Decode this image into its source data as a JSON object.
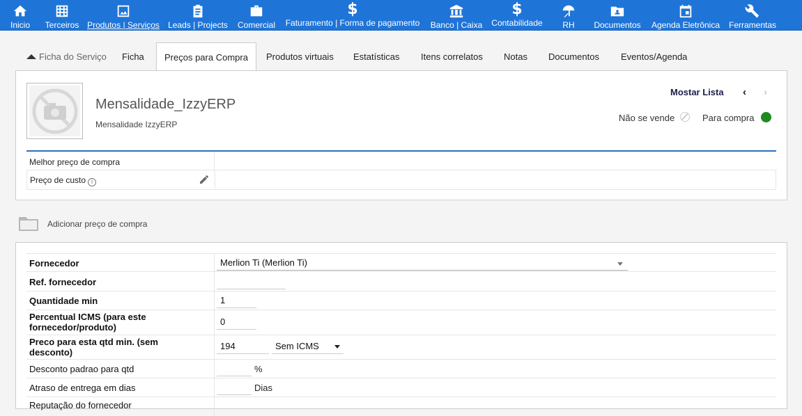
{
  "nav": {
    "items": [
      {
        "label": "Inicio",
        "icon": "home-icon"
      },
      {
        "label": "Terceiros",
        "icon": "building-icon"
      },
      {
        "label": "Produtos | Serviços",
        "icon": "image-icon"
      },
      {
        "label": "Leads | Projects",
        "icon": "clipboard-icon"
      },
      {
        "label": "Comercial",
        "icon": "briefcase-icon"
      },
      {
        "label": "Faturamento | Forma de pagamento",
        "icon": "dollar-icon"
      },
      {
        "label": "Banco | Caixa",
        "icon": "bank-icon"
      },
      {
        "label": "Contabilidade",
        "icon": "dollar-icon"
      },
      {
        "label": "RH",
        "icon": "umbrella-icon"
      },
      {
        "label": "Documentos",
        "icon": "folder-user-icon"
      },
      {
        "label": "Agenda Eletrônica",
        "icon": "calendar-icon"
      },
      {
        "label": "Ferramentas",
        "icon": "wrench-icon"
      }
    ],
    "dollar_glyph": "$"
  },
  "tabs": {
    "back": "Ficha do Serviço",
    "items": [
      "Ficha",
      "Preços para Compra",
      "Produtos virtuais",
      "Estatísticas",
      "Itens correlatos",
      "Notas",
      "Documentos",
      "Eventos/Agenda"
    ],
    "current": "Preços para Compra"
  },
  "product": {
    "title": "Mensalidade_IzzyERP",
    "subtitle": "Mensalidade IzzyERP",
    "mostrar_lista": "Mostar Lista",
    "prev_glyph": "‹",
    "next_glyph": "›",
    "nao_se_vende": "Não se vende",
    "para_compra": "Para compra",
    "status_on_color": "#1f8a1f"
  },
  "price_info": {
    "melhor_preco_label": "Melhor preço de compra",
    "preco_custo_label": "Preço de custo",
    "info_glyph": "i"
  },
  "add_price": {
    "label": "Adicionar preço de compra"
  },
  "form": {
    "fornecedor_label": "Fornecedor",
    "fornecedor_value": "Merlion Ti (Merlion Ti)",
    "ref_label": "Ref. fornecedor",
    "ref_value": "",
    "qtd_min_label": "Quantidade min",
    "qtd_min_value": "1",
    "icms_label_line1": "Percentual ICMS (para este",
    "icms_label_line2": "fornecedor/produto)",
    "icms_value": "0",
    "preco_label_line1": "Preco para esta qtd min. (sem",
    "preco_label_line2": "desconto)",
    "preco_value": "194",
    "tax_option": "Sem ICMS",
    "desconto_label": "Desconto padrao para qtd",
    "desconto_unit": "%",
    "atraso_label": "Atraso de entrega em dias",
    "atraso_unit": "Dias",
    "reputacao_label": "Reputação do fornecedor"
  },
  "colors": {
    "topbar": "#1f74d7",
    "accent_line": "#2b6fc1"
  }
}
